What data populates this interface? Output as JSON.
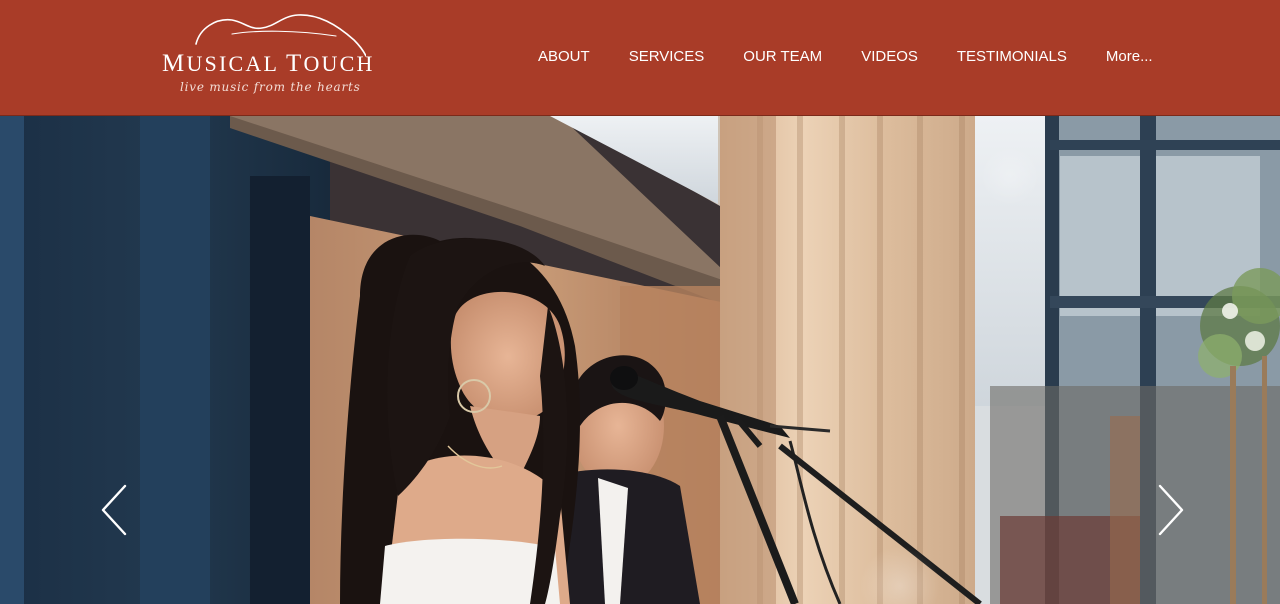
{
  "brand": {
    "title_first_big": "M",
    "title_first_rest": "USICAL",
    "title_second_big": "T",
    "title_second_rest": "OUCH",
    "tagline": "live music from the hearts"
  },
  "nav": {
    "items": [
      {
        "label": "ABOUT"
      },
      {
        "label": "SERVICES"
      },
      {
        "label": "OUR TEAM"
      },
      {
        "label": "VIDEOS"
      },
      {
        "label": "TESTIMONIALS"
      },
      {
        "label": "More..."
      }
    ]
  },
  "colors": {
    "header_bg": "#a93c28",
    "nav_text": "#ffffff"
  },
  "hero": {
    "prev_icon": "chevron-left-icon",
    "next_icon": "chevron-right-icon"
  }
}
